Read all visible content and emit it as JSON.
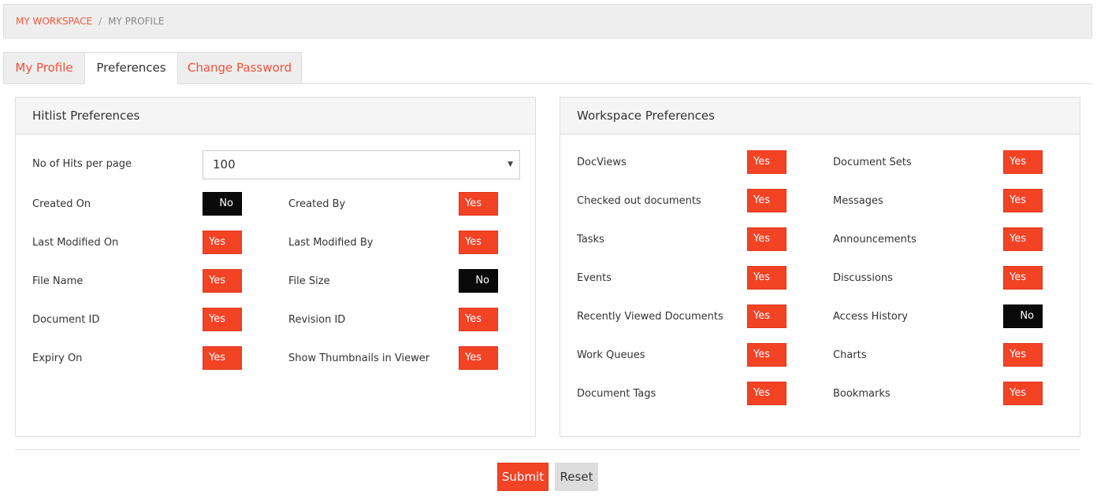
{
  "breadcrumb": {
    "items": [
      "MY WORKSPACE",
      "MY PROFILE"
    ],
    "separator": "/"
  },
  "tabs": [
    {
      "label": "My Profile"
    },
    {
      "label": "Preferences",
      "active": true
    },
    {
      "label": "Change Password"
    }
  ],
  "hitlist": {
    "title": "Hitlist Preferences",
    "hits_label": "No of Hits per page",
    "hits_value": "100",
    "items": [
      {
        "label": "Created On",
        "value": "No"
      },
      {
        "label": "Created By",
        "value": "Yes"
      },
      {
        "label": "Last Modified On",
        "value": "Yes"
      },
      {
        "label": "Last Modified By",
        "value": "Yes"
      },
      {
        "label": "File Name",
        "value": "Yes"
      },
      {
        "label": "File Size",
        "value": "No"
      },
      {
        "label": "Document ID",
        "value": "Yes"
      },
      {
        "label": "Revision ID",
        "value": "Yes"
      },
      {
        "label": "Expiry On",
        "value": "Yes"
      },
      {
        "label": "Show Thumbnails in Viewer",
        "value": "Yes"
      }
    ]
  },
  "workspace": {
    "title": "Workspace Preferences",
    "items": [
      {
        "label": "DocViews",
        "value": "Yes"
      },
      {
        "label": "Document Sets",
        "value": "Yes"
      },
      {
        "label": "Checked out documents",
        "value": "Yes"
      },
      {
        "label": "Messages",
        "value": "Yes"
      },
      {
        "label": "Tasks",
        "value": "Yes"
      },
      {
        "label": "Announcements",
        "value": "Yes"
      },
      {
        "label": "Events",
        "value": "Yes"
      },
      {
        "label": "Discussions",
        "value": "Yes"
      },
      {
        "label": "Recently Viewed Documents",
        "value": "Yes"
      },
      {
        "label": "Access History",
        "value": "No"
      },
      {
        "label": "Work Queues",
        "value": "Yes"
      },
      {
        "label": "Charts",
        "value": "Yes"
      },
      {
        "label": "Document Tags",
        "value": "Yes"
      },
      {
        "label": "Bookmarks",
        "value": "Yes"
      }
    ]
  },
  "actions": {
    "submit": "Submit",
    "reset": "Reset"
  },
  "colors": {
    "accent": "#f24325",
    "off": "#0a0a0a"
  }
}
